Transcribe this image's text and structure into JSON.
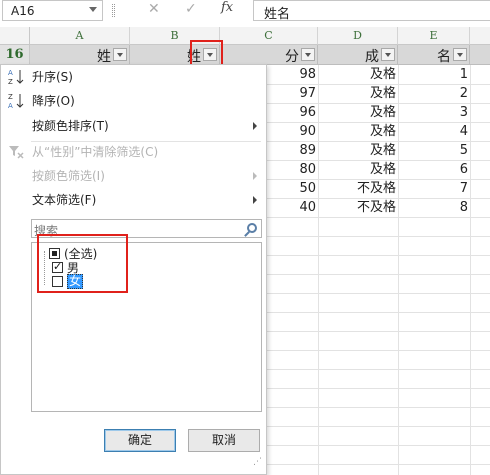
{
  "formula_bar": {
    "name_box": "A16",
    "cancel_icon": "✕",
    "confirm_icon": "✓",
    "fx_label": "fx",
    "content": "姓名"
  },
  "columns": [
    "A",
    "B",
    "C",
    "D",
    "E"
  ],
  "row_number": "16",
  "header_cells": [
    "姓",
    "姓",
    "分",
    "成",
    "名"
  ],
  "data_rows": [
    {
      "score": "98",
      "grade": "及格",
      "rank": "1"
    },
    {
      "score": "97",
      "grade": "及格",
      "rank": "2"
    },
    {
      "score": "96",
      "grade": "及格",
      "rank": "3"
    },
    {
      "score": "90",
      "grade": "及格",
      "rank": "4"
    },
    {
      "score": "89",
      "grade": "及格",
      "rank": "5"
    },
    {
      "score": "80",
      "grade": "及格",
      "rank": "6"
    },
    {
      "score": "50",
      "grade": "不及格",
      "rank": "7"
    },
    {
      "score": "40",
      "grade": "不及格",
      "rank": "8"
    }
  ],
  "menu": {
    "sort_asc": "升序(S)",
    "sort_desc": "降序(O)",
    "sort_by_color": "按颜色排序(T)",
    "clear_filter": "从“性别”中清除筛选(C)",
    "filter_by_color": "按颜色筛选(I)",
    "text_filter": "文本筛选(F)",
    "search_placeholder": "搜索",
    "list": [
      {
        "label": "(全选)",
        "state": "partial"
      },
      {
        "label": "男",
        "state": "checked"
      },
      {
        "label": "女",
        "state": "unchecked"
      }
    ],
    "ok": "确定",
    "cancel": "取消"
  },
  "colors": {
    "highlight_red": "#e0211b",
    "header_green": "#2f6a2e",
    "selection_blue": "#3399ff"
  }
}
